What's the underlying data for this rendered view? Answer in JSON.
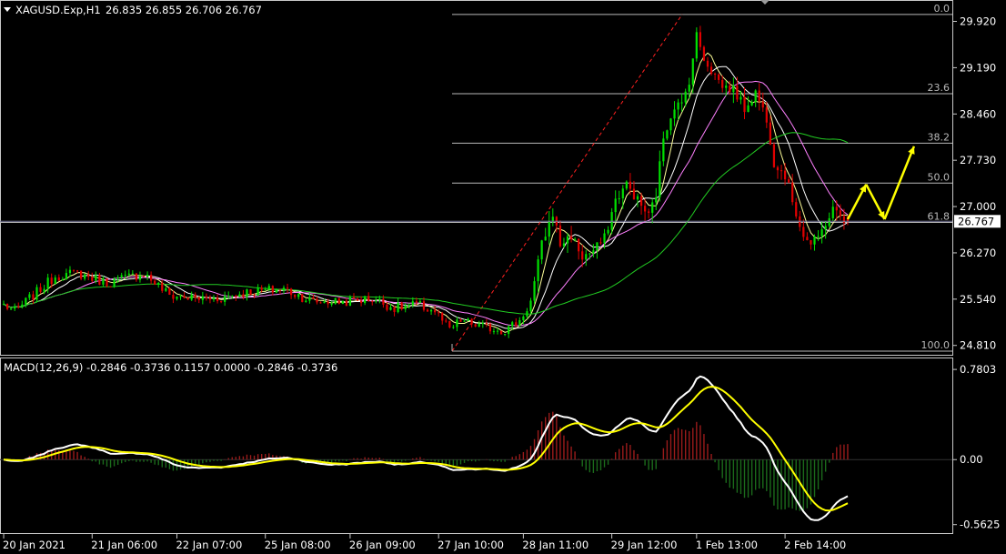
{
  "colors": {
    "background": "#000000",
    "frame": "#c8c8c8",
    "text": "#ffffff",
    "bull": "#00e000",
    "bear": "#e00000",
    "ma_fast": "#ffff99",
    "ma_mid": "#ffffff",
    "ma_slow": "#ff80ff",
    "ma_long": "#22cc22",
    "fib": "#b8b8b8",
    "trend": "#ff2020",
    "forecast": "#ffff00",
    "macd_line": "#ffffff",
    "signal_line": "#ffff00",
    "hist_pos": "#9b1b1b",
    "hist_neg": "#1b6b1b",
    "price_box": "#ffffff",
    "price_text": "#000000"
  },
  "header": {
    "symbol": "XAGUSD.Exp,H1",
    "ohlc": "26.835 26.855 26.706 26.767"
  },
  "macd_header": {
    "name": "MACD(12,26,9)",
    "values": "-0.2846 -0.3736 0.1157 0.0000 -0.2846 -0.3736"
  },
  "current_price": "26.767",
  "chart_data": [
    {
      "type": "candlestick",
      "title": "XAGUSD.Exp,H1",
      "x_ticks": [
        "20 Jan 2021",
        "21 Jan 06:00",
        "22 Jan 07:00",
        "25 Jan 08:00",
        "26 Jan 09:00",
        "27 Jan 10:00",
        "28 Jan 11:00",
        "29 Jan 12:00",
        "1 Feb 13:00",
        "2 Feb 14:00"
      ],
      "y_ticks": [
        "29.920",
        "29.190",
        "28.460",
        "27.730",
        "27.000",
        "26.270",
        "25.540",
        "24.810"
      ],
      "ylim": [
        24.72,
        30.2
      ],
      "fibonacci": {
        "high": 30.03,
        "low": 24.72,
        "levels": [
          {
            "label": "0.0",
            "value": 30.03
          },
          {
            "label": "23.6",
            "value": 28.78
          },
          {
            "label": "38.2",
            "value": 28.0
          },
          {
            "label": "50.0",
            "value": 27.37
          },
          {
            "label": "61.8",
            "value": 26.75
          },
          {
            "label": "100.0",
            "value": 24.72
          }
        ]
      },
      "anchor_points": [
        [
          0,
          25.45
        ],
        [
          3,
          25.35
        ],
        [
          8,
          25.6
        ],
        [
          14,
          25.9
        ],
        [
          20,
          25.95
        ],
        [
          28,
          25.8
        ],
        [
          38,
          25.95
        ],
        [
          45,
          25.6
        ],
        [
          52,
          25.55
        ],
        [
          58,
          25.55
        ],
        [
          66,
          25.65
        ],
        [
          76,
          25.7
        ],
        [
          84,
          25.5
        ],
        [
          92,
          25.5
        ],
        [
          100,
          25.55
        ],
        [
          106,
          25.4
        ],
        [
          112,
          25.45
        ],
        [
          117,
          25.35
        ],
        [
          121,
          25.05
        ],
        [
          124,
          25.2
        ],
        [
          130,
          25.1
        ],
        [
          136,
          25.05
        ],
        [
          140,
          25.2
        ],
        [
          143,
          25.5
        ],
        [
          146,
          26.4
        ],
        [
          149,
          26.9
        ],
        [
          151,
          26.4
        ],
        [
          154,
          26.55
        ],
        [
          157,
          26.2
        ],
        [
          160,
          26.3
        ],
        [
          163,
          26.5
        ],
        [
          166,
          27.1
        ],
        [
          169,
          27.35
        ],
        [
          172,
          27.1
        ],
        [
          175,
          26.85
        ],
        [
          177,
          27.2
        ],
        [
          179,
          28.1
        ],
        [
          182,
          28.6
        ],
        [
          184,
          28.6
        ],
        [
          186,
          29.0
        ],
        [
          188,
          29.7
        ],
        [
          190,
          29.35
        ],
        [
          192,
          29.15
        ],
        [
          195,
          28.9
        ],
        [
          198,
          28.85
        ],
        [
          201,
          28.55
        ],
        [
          204,
          28.8
        ],
        [
          207,
          28.4
        ],
        [
          209,
          27.7
        ],
        [
          212,
          27.5
        ],
        [
          215,
          26.9
        ],
        [
          217,
          26.55
        ],
        [
          219,
          26.4
        ],
        [
          221,
          26.5
        ],
        [
          223,
          26.75
        ],
        [
          225,
          26.95
        ],
        [
          227,
          26.85
        ],
        [
          229,
          26.77
        ]
      ],
      "ma_periods": [
        5,
        10,
        20,
        50
      ]
    },
    {
      "type": "macd",
      "title": "MACD(12,26,9)",
      "y_ticks": [
        "0.7803",
        "0.00",
        "-0.5625"
      ],
      "ylim": [
        -0.62,
        0.86
      ],
      "forecast_path": [
        [
          229,
          26.8
        ],
        [
          234,
          27.35
        ],
        [
          239,
          26.8
        ],
        [
          247,
          27.95
        ]
      ]
    }
  ]
}
